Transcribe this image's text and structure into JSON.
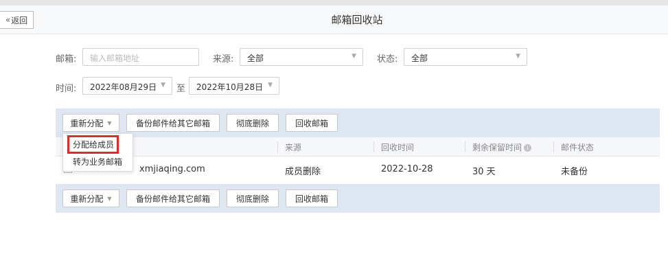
{
  "header": {
    "back_label": "返回",
    "back_icon": "double-chevron-left-icon",
    "title": "邮箱回收站"
  },
  "filters": {
    "email_label": "邮箱:",
    "email_placeholder": "输入邮箱地址",
    "source_label": "来源:",
    "source_value": "全部",
    "status_label": "状态:",
    "status_value": "全部",
    "time_label": "时间:",
    "time_start": "2022年08月29日",
    "time_to": "至",
    "time_end": "2022年10月28日"
  },
  "toolbar": {
    "reassign_label": "重新分配",
    "backup_label": "备份邮件给其它邮箱",
    "delete_label": "彻底删除",
    "recover_label": "回收邮箱"
  },
  "dropdown": {
    "items": [
      "分配给成员",
      "转为业务邮箱"
    ],
    "highlight_color": "#e02b2b"
  },
  "table": {
    "headers": [
      "来源",
      "回收时间",
      "剩余保留时间",
      "邮件状态"
    ],
    "rows": [
      {
        "email": "xmjiaqing.com",
        "source": "成员删除",
        "recycle_time": "2022-10-28",
        "remaining": "30 天",
        "mail_status": "未备份"
      }
    ]
  },
  "colors": {
    "toolbar_bg": "#dde6f1",
    "header_bg": "#f7f8fa"
  }
}
